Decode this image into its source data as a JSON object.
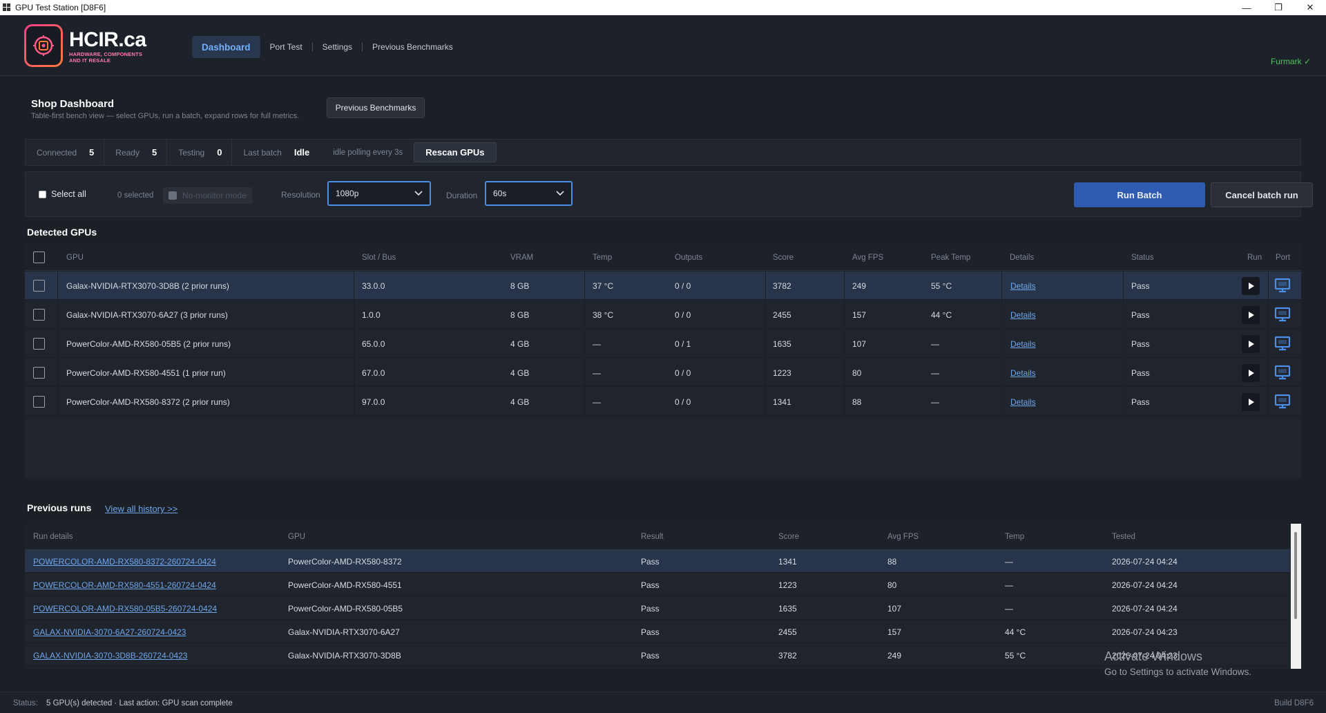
{
  "window": {
    "title": "GPU Test Station  [D8F6]",
    "minimize": "—",
    "maximize": "❐",
    "close": "✕"
  },
  "brand": {
    "name": "HCIR.ca",
    "tagline_1": "HARDWARE, COMPONENTS",
    "tagline_2": "AND IT RESALE"
  },
  "nav": {
    "items": [
      {
        "label": "Dashboard",
        "active": true
      },
      {
        "label": "Port Test"
      },
      {
        "label": "Settings"
      },
      {
        "label": "Previous Benchmarks"
      }
    ],
    "furmark": "Furmark ✓"
  },
  "dashboard": {
    "title": "Shop Dashboard",
    "subtitle": "Table-first bench view — select GPUs, run a batch, expand rows for full metrics.",
    "prev_benchmarks_button": "Previous Benchmarks"
  },
  "stats": {
    "connected_label": "Connected",
    "connected": "5",
    "ready_label": "Ready",
    "ready": "5",
    "testing_label": "Testing",
    "testing": "0",
    "last_batch_label": "Last batch",
    "last_batch": "Idle",
    "polling": "idle polling every 3s",
    "rescan_button": "Rescan GPUs"
  },
  "controls": {
    "select_all": "Select all",
    "selected_count": "0 selected",
    "no_monitor": "No-monitor mode",
    "resolution_label": "Resolution",
    "resolution_value": "1080p",
    "duration_label": "Duration",
    "duration_value": "60s",
    "run_batch": "Run Batch",
    "cancel_batch": "Cancel batch run"
  },
  "detected": {
    "title": "Detected GPUs",
    "columns": [
      "GPU",
      "Slot / Bus",
      "VRAM",
      "Temp",
      "Outputs",
      "Score",
      "Avg FPS",
      "Peak Temp",
      "Details",
      "Status",
      "Run",
      "Port"
    ],
    "rows": [
      {
        "gpu": "Galax-NVIDIA-RTX3070-3D8B  (2 prior runs)",
        "slot": "33.0.0",
        "vram": "8 GB",
        "temp": "37 °C",
        "outputs": "0 / 0",
        "score": "3782",
        "fps": "249",
        "peak": "55 °C",
        "details": "Details",
        "status": "Pass"
      },
      {
        "gpu": "Galax-NVIDIA-RTX3070-6A27  (3 prior runs)",
        "slot": "1.0.0",
        "vram": "8 GB",
        "temp": "38 °C",
        "outputs": "0 / 0",
        "score": "2455",
        "fps": "157",
        "peak": "44 °C",
        "details": "Details",
        "status": "Pass"
      },
      {
        "gpu": "PowerColor-AMD-RX580-05B5  (2 prior runs)",
        "slot": "65.0.0",
        "vram": "4 GB",
        "temp": "—",
        "outputs": "0 / 1",
        "score": "1635",
        "fps": "107",
        "peak": "—",
        "details": "Details",
        "status": "Pass"
      },
      {
        "gpu": "PowerColor-AMD-RX580-4551  (1 prior run)",
        "slot": "67.0.0",
        "vram": "4 GB",
        "temp": "—",
        "outputs": "0 / 0",
        "score": "1223",
        "fps": "80",
        "peak": "—",
        "details": "Details",
        "status": "Pass"
      },
      {
        "gpu": "PowerColor-AMD-RX580-8372  (2 prior runs)",
        "slot": "97.0.0",
        "vram": "4 GB",
        "temp": "—",
        "outputs": "0 / 0",
        "score": "1341",
        "fps": "88",
        "peak": "—",
        "details": "Details",
        "status": "Pass"
      }
    ]
  },
  "runs": {
    "title": "Previous runs",
    "view_all": "View all history >>",
    "columns": [
      "Run details",
      "GPU",
      "Result",
      "Score",
      "Avg FPS",
      "Temp",
      "Tested"
    ],
    "rows": [
      {
        "run": "POWERCOLOR-AMD-RX580-8372-260724-0424",
        "gpu": "PowerColor-AMD-RX580-8372",
        "result": "Pass",
        "score": "1341",
        "fps": "88",
        "temp": "—",
        "tested": "2026-07-24 04:24"
      },
      {
        "run": "POWERCOLOR-AMD-RX580-4551-260724-0424",
        "gpu": "PowerColor-AMD-RX580-4551",
        "result": "Pass",
        "score": "1223",
        "fps": "80",
        "temp": "—",
        "tested": "2026-07-24 04:24"
      },
      {
        "run": "POWERCOLOR-AMD-RX580-05B5-260724-0424",
        "gpu": "PowerColor-AMD-RX580-05B5",
        "result": "Pass",
        "score": "1635",
        "fps": "107",
        "temp": "—",
        "tested": "2026-07-24 04:24"
      },
      {
        "run": "GALAX-NVIDIA-3070-6A27-260724-0423",
        "gpu": "Galax-NVIDIA-RTX3070-6A27",
        "result": "Pass",
        "score": "2455",
        "fps": "157",
        "temp": "44 °C",
        "tested": "2026-07-24 04:23"
      },
      {
        "run": "GALAX-NVIDIA-3070-3D8B-260724-0423",
        "gpu": "Galax-NVIDIA-RTX3070-3D8B",
        "result": "Pass",
        "score": "3782",
        "fps": "249",
        "temp": "55 °C",
        "tested": "2026-07-24 04:23"
      }
    ]
  },
  "watermark": {
    "line1": "Activate Windows",
    "line2": "Go to Settings to activate Windows."
  },
  "statusbar": {
    "label": "Status:",
    "text": "5 GPU(s) detected · Last action: GPU scan complete",
    "build": "Build D8F6"
  },
  "colors": {
    "accent": "#4b8fe8",
    "link": "#6fa7ec",
    "ok": "#4fc35e",
    "run_button": "#2e5cb0"
  },
  "icons": {
    "play": "play-icon",
    "port": "monitor-icon",
    "dropdown": "chevron-down-icon"
  }
}
